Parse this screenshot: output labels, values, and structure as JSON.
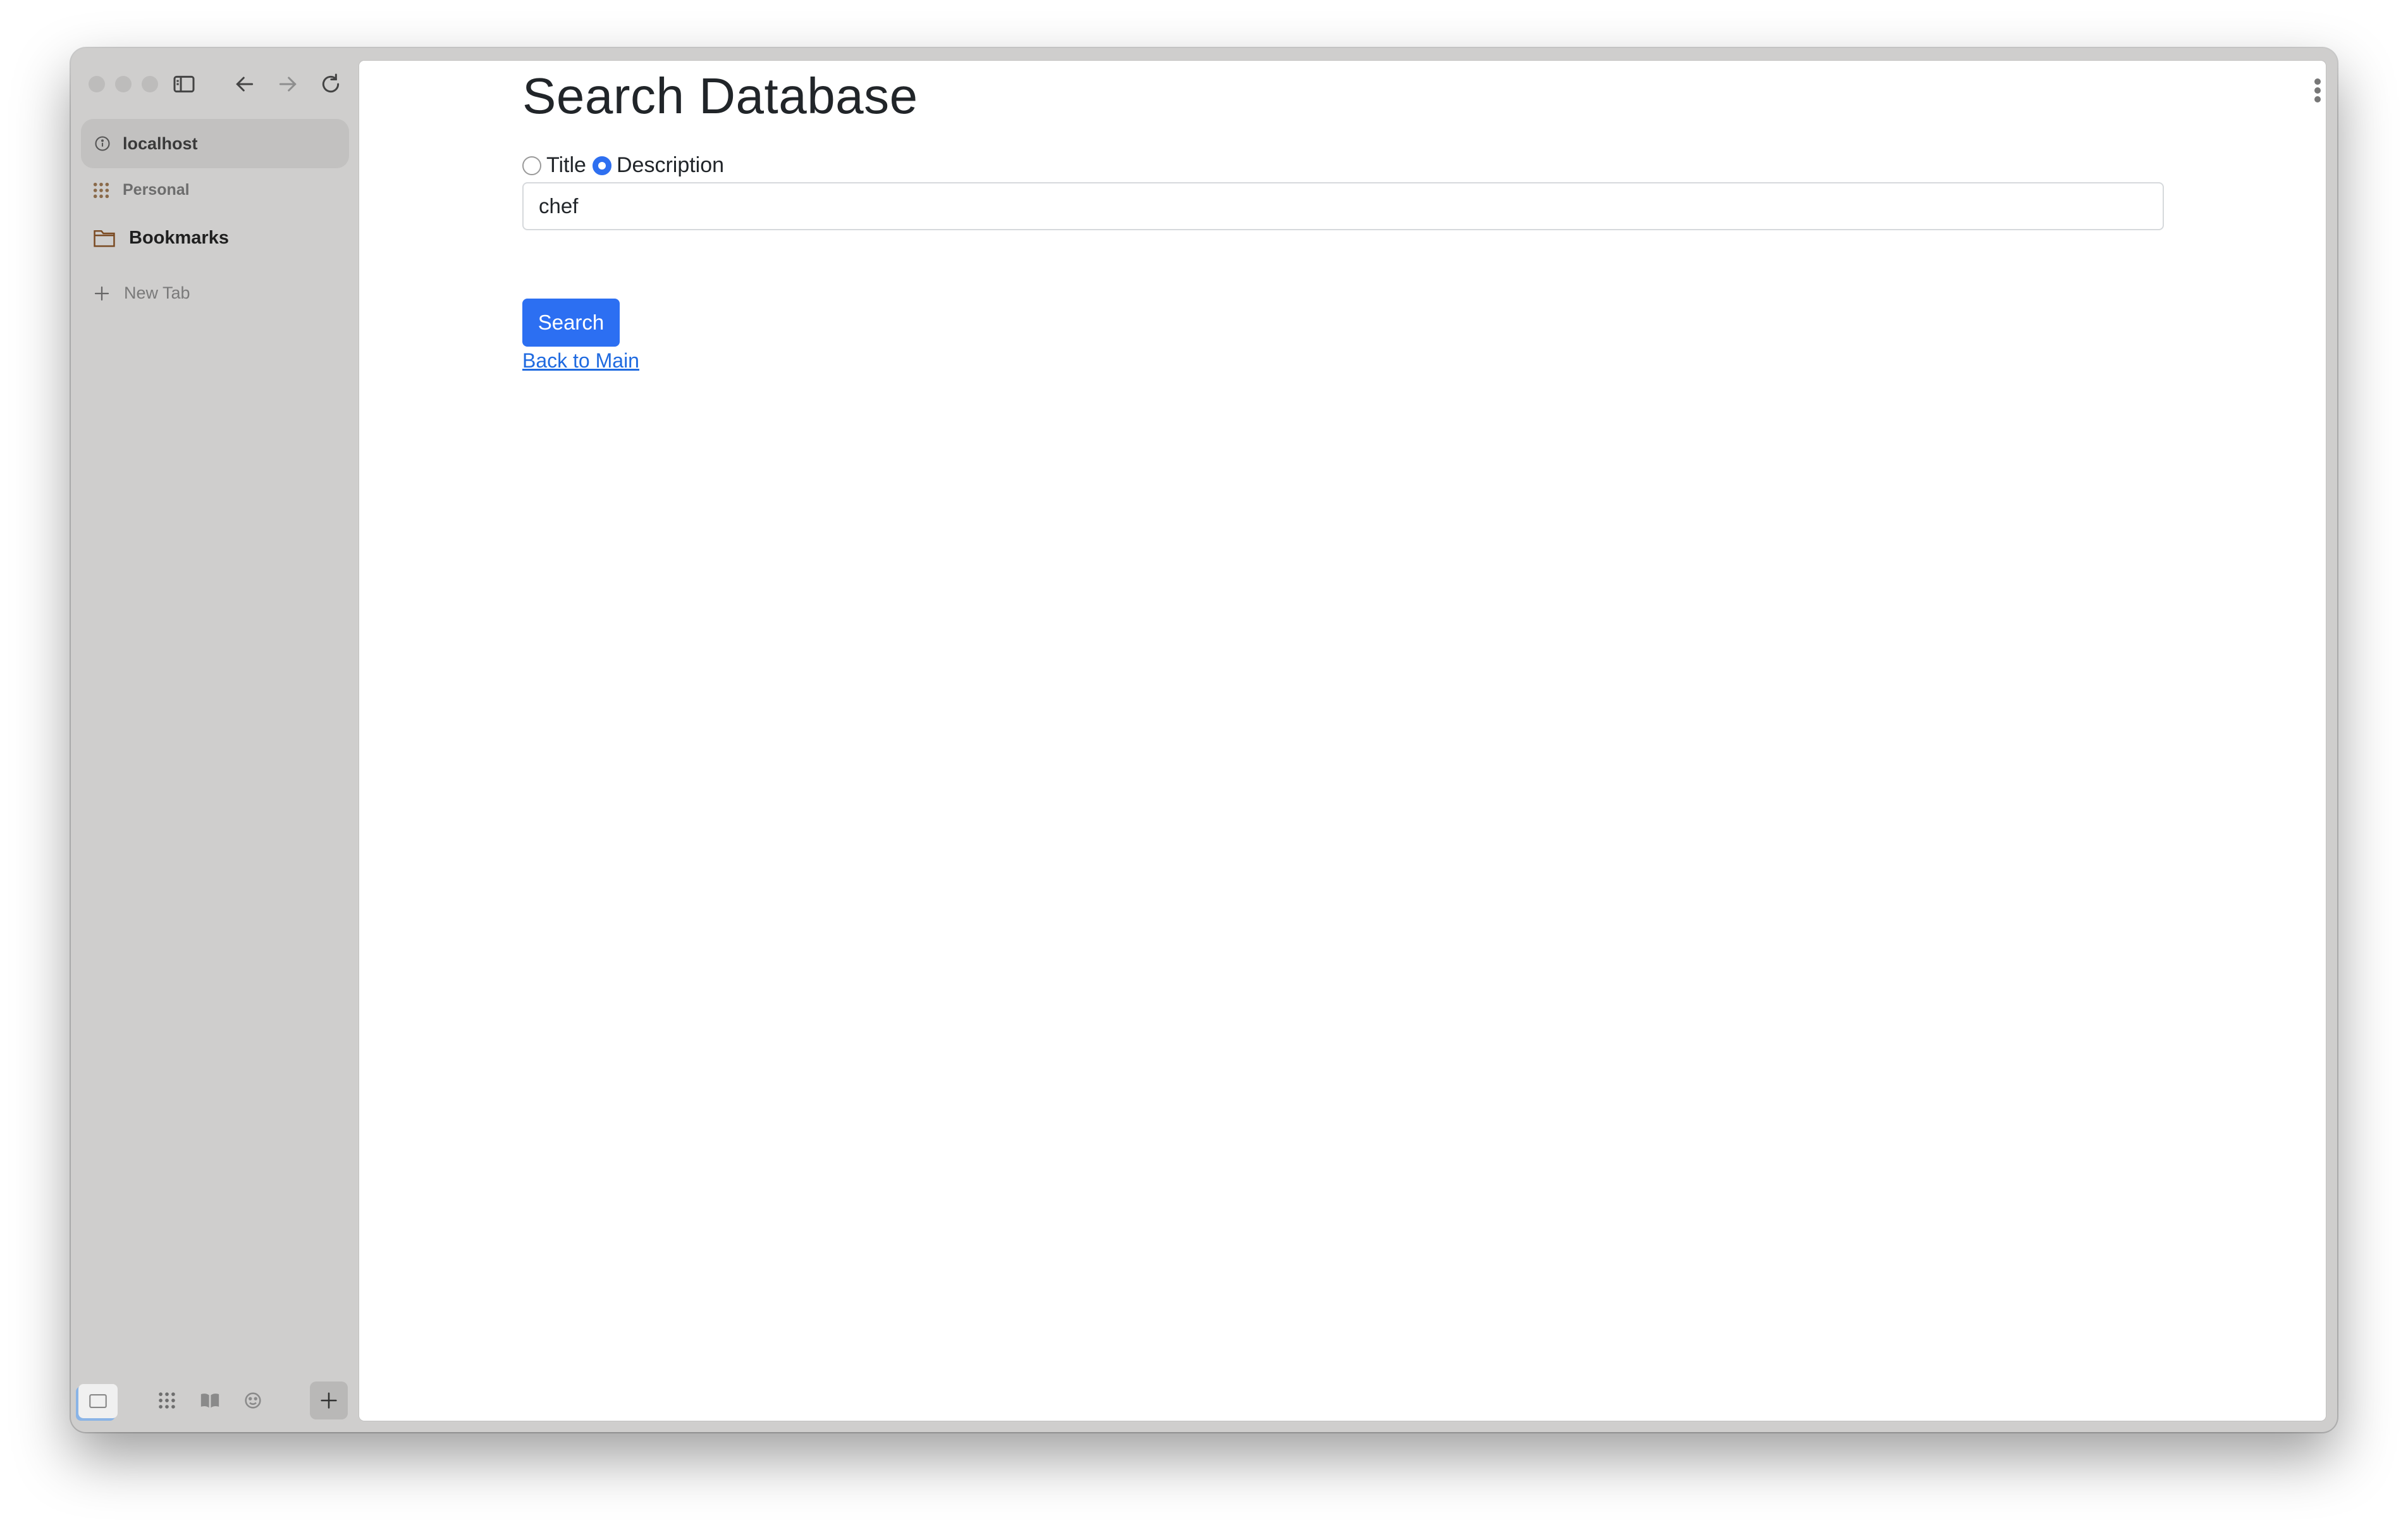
{
  "browser": {
    "url": "localhost",
    "sidebar": {
      "personal_label": "Personal",
      "bookmarks_label": "Bookmarks",
      "new_tab_label": "New Tab"
    }
  },
  "page": {
    "title": "Search Database",
    "radio_options": [
      {
        "label": "Title",
        "checked": false
      },
      {
        "label": "Description",
        "checked": true
      }
    ],
    "search_value": "chef",
    "search_button_label": "Search",
    "back_link_label": "Back to Main"
  },
  "colors": {
    "accent": "#2c6ff2",
    "link": "#1f6ae0",
    "sidebar_bg": "#cfcecd"
  }
}
